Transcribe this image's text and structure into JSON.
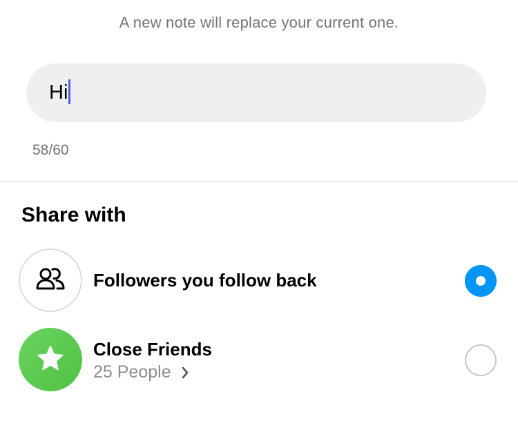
{
  "hint_text": "A new note will replace your current one.",
  "note": {
    "value": "Hi",
    "counter": "58/60"
  },
  "share": {
    "title": "Share with",
    "options": [
      {
        "label": "Followers you follow back",
        "icon": "people-icon",
        "selected": true
      },
      {
        "label": "Close Friends",
        "sublabel": "25 People",
        "icon": "star-icon",
        "selected": false
      }
    ]
  },
  "colors": {
    "accent_blue": "#0095f6",
    "close_friends_green": "#56c84a",
    "caret": "#4a5ee8"
  }
}
